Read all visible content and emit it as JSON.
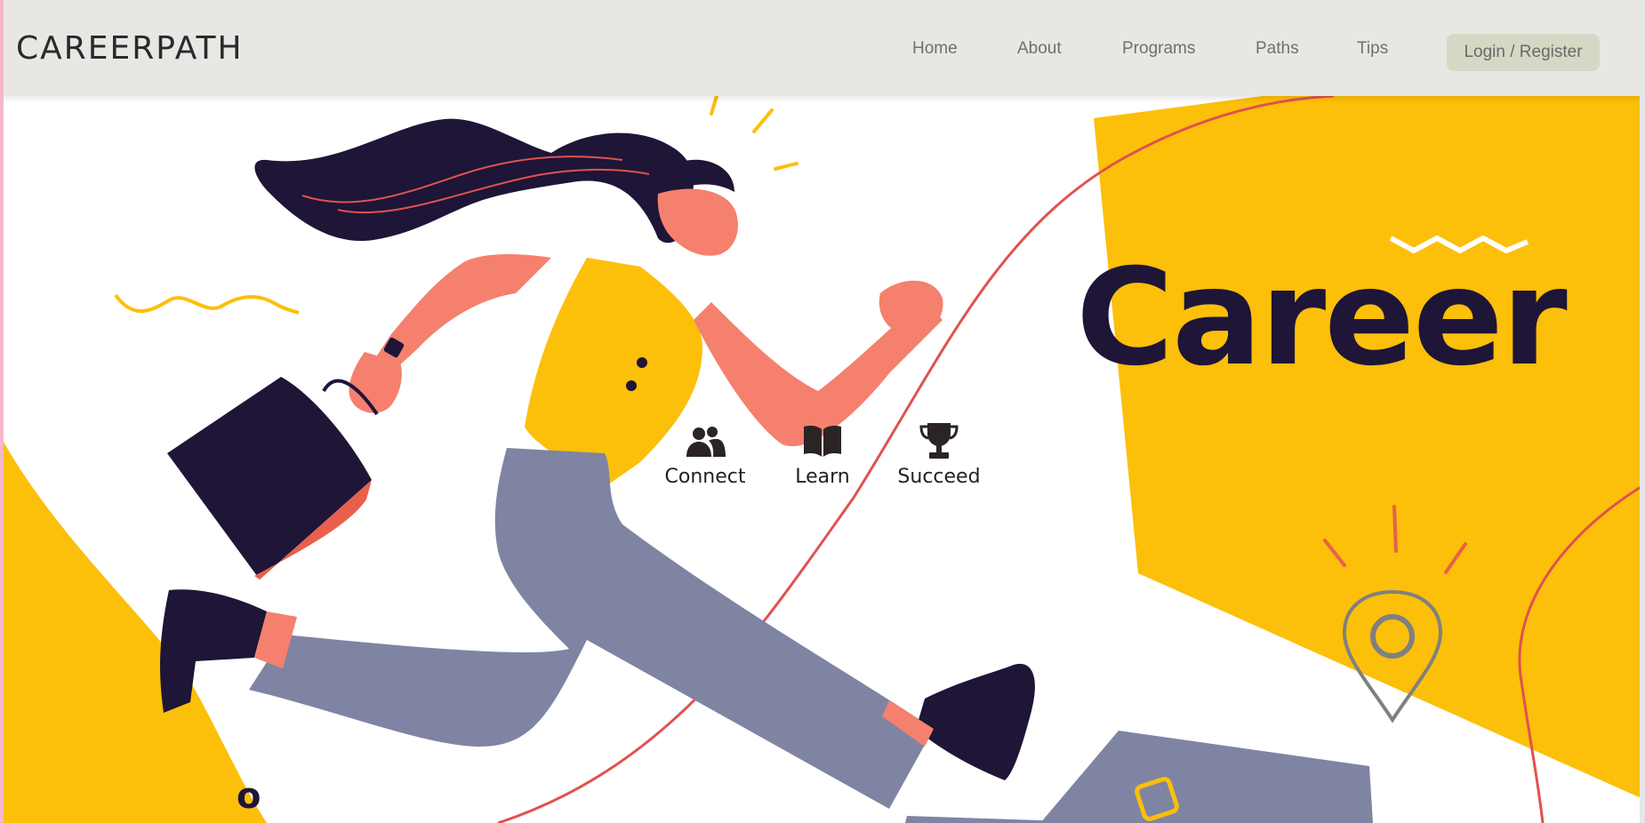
{
  "header": {
    "brand": "CAREERPATH",
    "nav": [
      {
        "label": "Home"
      },
      {
        "label": "About"
      },
      {
        "label": "Programs"
      },
      {
        "label": "Paths"
      },
      {
        "label": "Tips"
      }
    ],
    "login_label": "Login / Register"
  },
  "hero": {
    "title": "Career",
    "features": [
      {
        "label": "Connect",
        "icon": "people-icon"
      },
      {
        "label": "Learn",
        "icon": "book-icon"
      },
      {
        "label": "Succeed",
        "icon": "trophy-icon"
      }
    ],
    "corner_mark": "o"
  },
  "colors": {
    "accent_yellow": "#fcbf0a",
    "navy": "#1e1537",
    "coral": "#f5806e",
    "slate": "#7f84a3",
    "red_line": "#e0524e",
    "nav_bg": "#e8e7e3",
    "button_bg": "#d7d7c6"
  }
}
